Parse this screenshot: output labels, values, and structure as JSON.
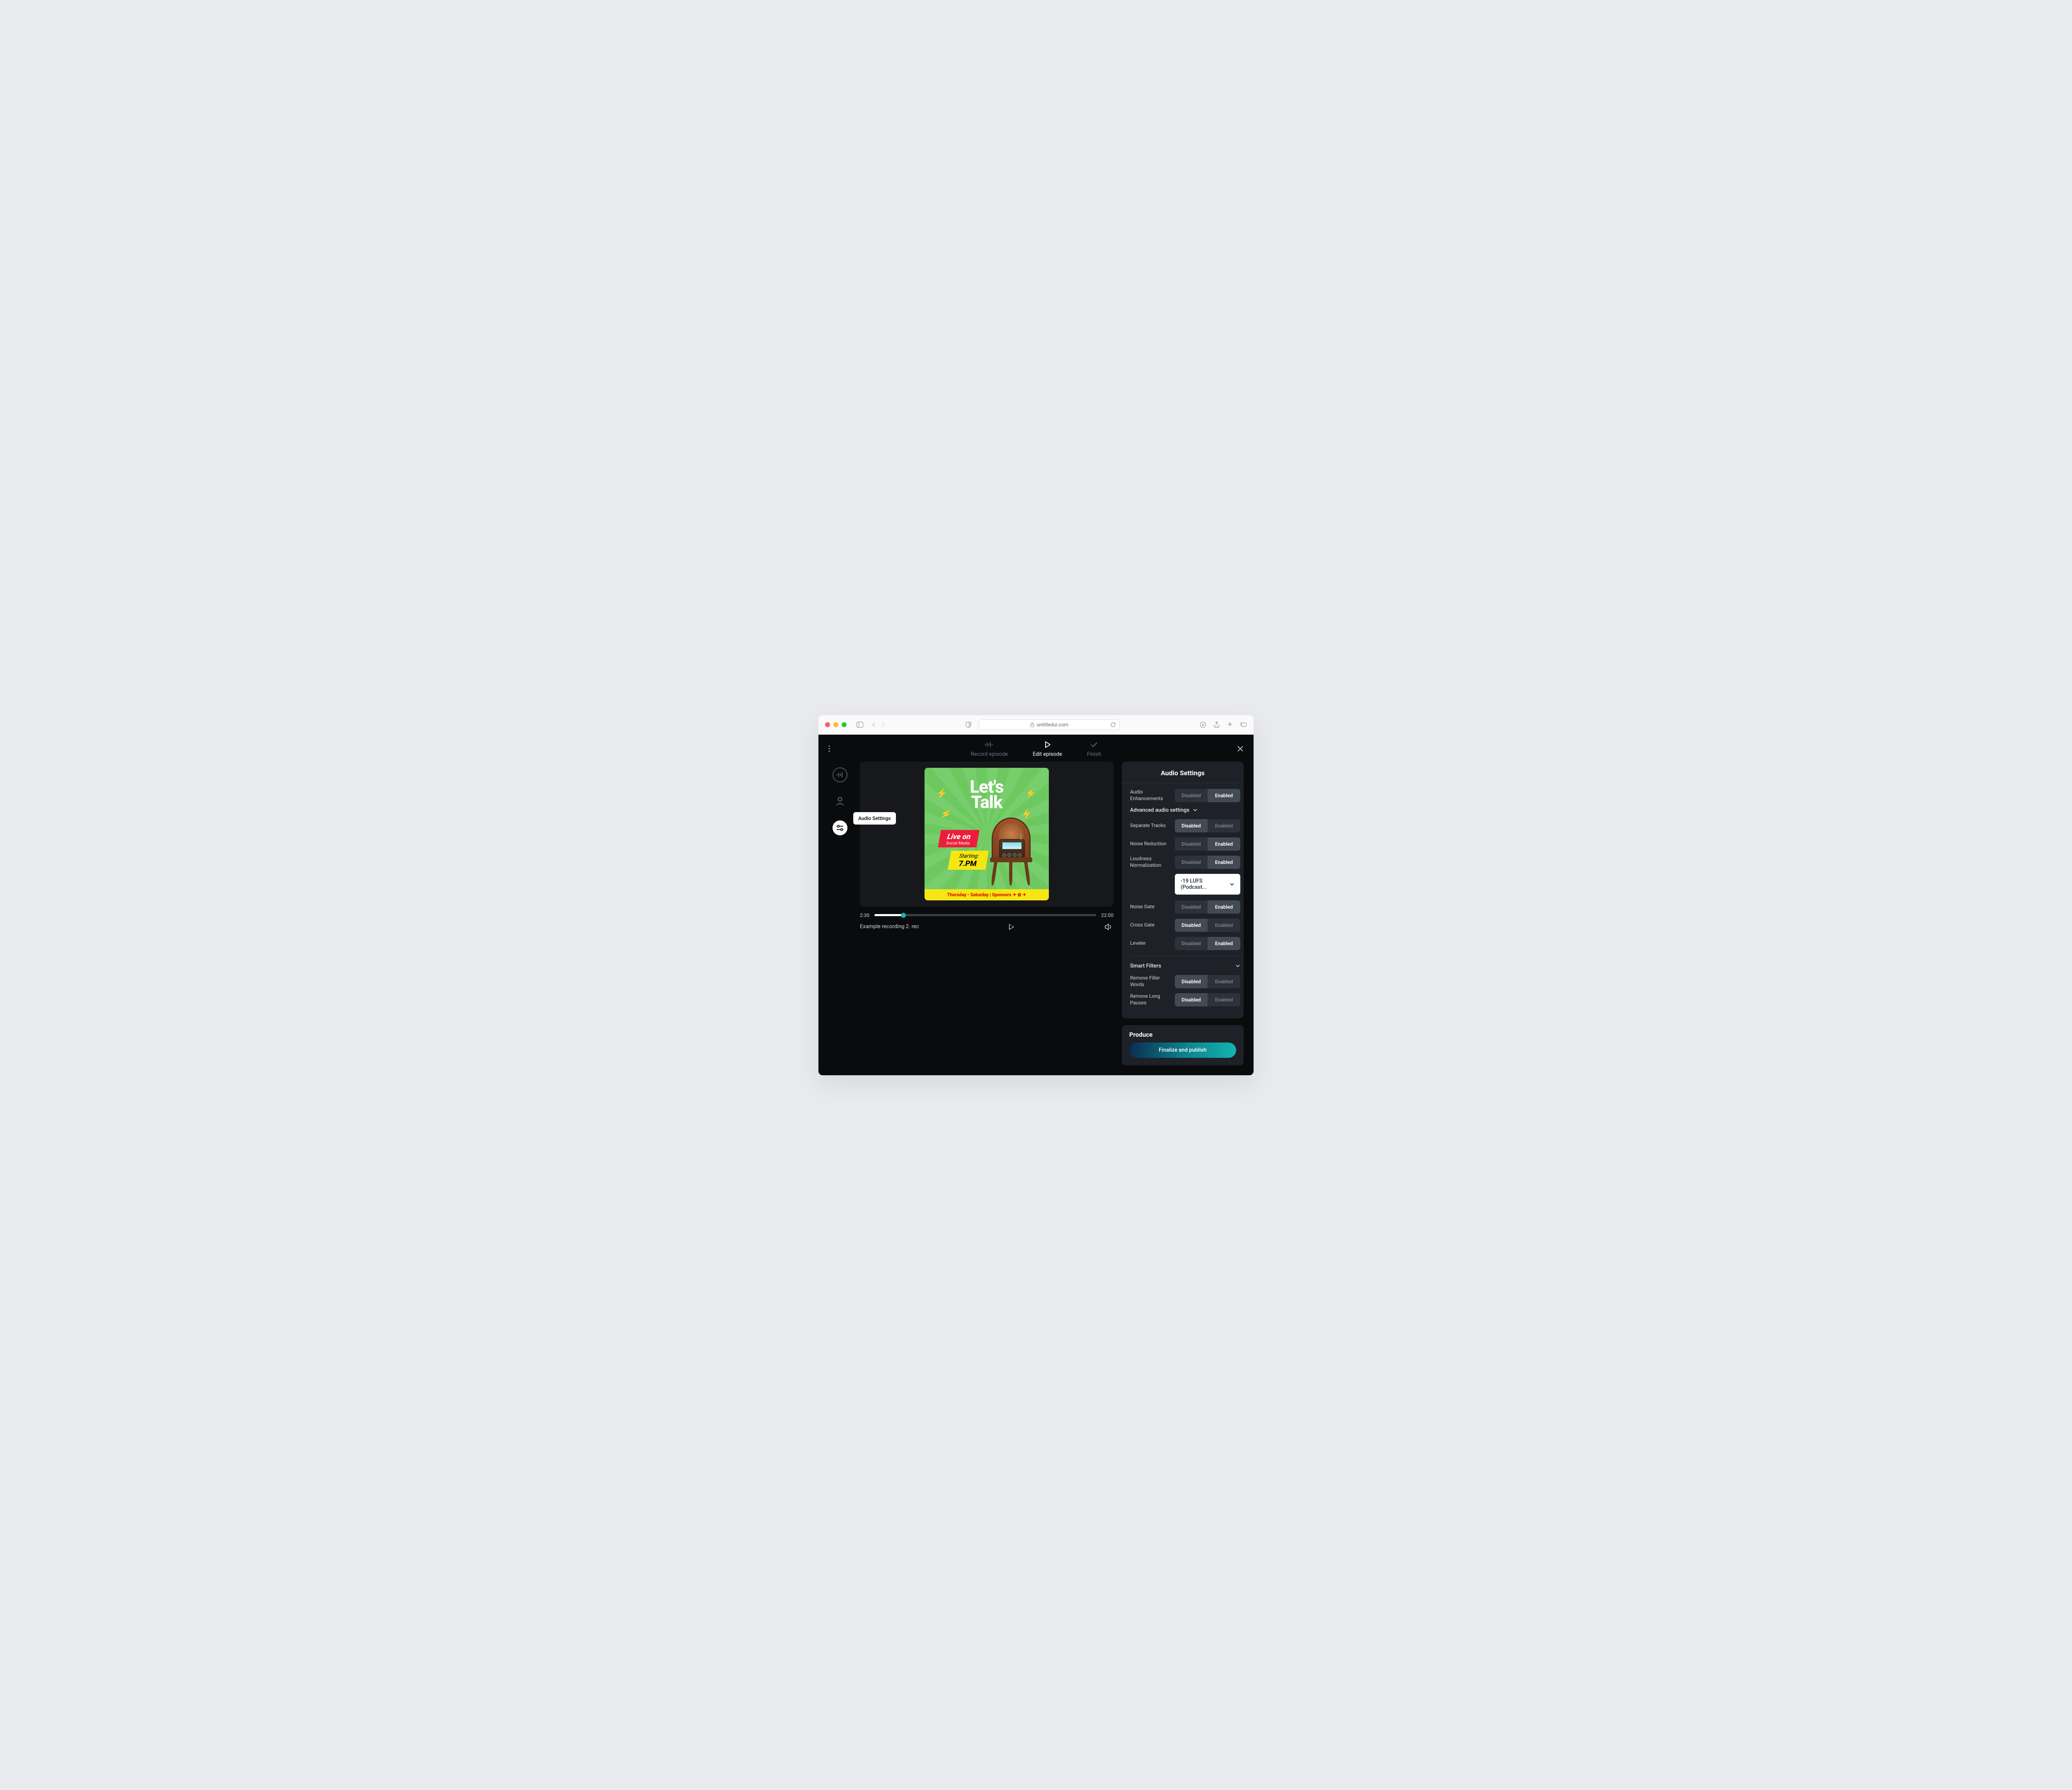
{
  "browser": {
    "url": "untitledui.com"
  },
  "topbar": {
    "steps": [
      {
        "label": "Record episode",
        "active": false
      },
      {
        "label": "Edit episode",
        "active": true
      },
      {
        "label": "Finish",
        "active": false
      }
    ]
  },
  "rail": {
    "tooltip": "Audio Settings"
  },
  "cover": {
    "title_line1": "Let's",
    "title_line2": "Talk",
    "red_line1": "Live on",
    "red_line2": "Social Media",
    "yellow_line1": "Starting:",
    "yellow_line2": "7.PM",
    "footer": "Thursday - Saturday  |  Sponsors ✦ ✿ ✦"
  },
  "player": {
    "current_time": "2:30",
    "total_time": "22:00",
    "file_name": "Example recording 2. rec"
  },
  "panel": {
    "title": "Audio Settings",
    "enabled_label": "Enabled",
    "disabled_label": "Disabled",
    "advanced_label": "Advanced audio settings",
    "lufs_value": "-19 LUFS (Podcast...",
    "smart_filters_label": "Smart Filters",
    "settings": {
      "audio_enhancements": {
        "label": "Audio Enhancements",
        "value": "enabled"
      },
      "separate_tracks": {
        "label": "Separate Tracks",
        "value": "disabled"
      },
      "noise_reduction": {
        "label": "Noise Reduction",
        "value": "enabled"
      },
      "loudness_norm": {
        "label": "Loudness Normalization",
        "value": "enabled"
      },
      "noise_gate": {
        "label": "Noise Gate",
        "value": "enabled"
      },
      "cross_gate": {
        "label": "Cross Gate",
        "value": "disabled"
      },
      "leveler": {
        "label": "Leveler",
        "value": "enabled"
      },
      "remove_filler": {
        "label": "Remove Filler Words",
        "value": "disabled"
      },
      "remove_pauses": {
        "label": "Remove Long Pauses",
        "value": "disabled"
      }
    }
  },
  "produce": {
    "title": "Produce",
    "button": "Finalize and publish"
  }
}
